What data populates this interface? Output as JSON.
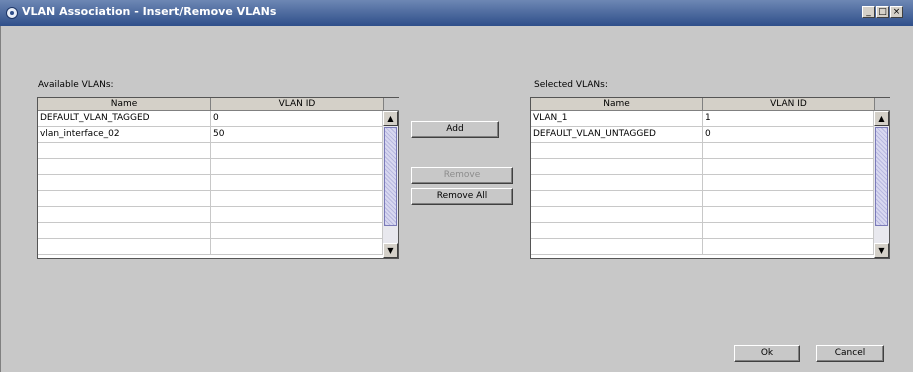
{
  "window": {
    "title": "VLAN Association - Insert/Remove VLANs",
    "controls": {
      "minimize": "_",
      "maximize": "□",
      "close": "×"
    }
  },
  "available": {
    "label": "Available VLANs:",
    "columns": [
      "Name",
      "VLAN ID"
    ],
    "rows": [
      [
        "DEFAULT_VLAN_TAGGED",
        "0"
      ],
      [
        "vlan_interface_02",
        "50"
      ],
      [
        "",
        ""
      ],
      [
        "",
        ""
      ],
      [
        "",
        ""
      ],
      [
        "",
        ""
      ],
      [
        "",
        ""
      ],
      [
        "",
        ""
      ],
      [
        "",
        ""
      ]
    ]
  },
  "selected": {
    "label": "Selected VLANs:",
    "columns": [
      "Name",
      "VLAN ID"
    ],
    "rows": [
      [
        "VLAN_1",
        "1"
      ],
      [
        "DEFAULT_VLAN_UNTAGGED",
        "0"
      ],
      [
        "",
        ""
      ],
      [
        "",
        ""
      ],
      [
        "",
        ""
      ],
      [
        "",
        ""
      ],
      [
        "",
        ""
      ],
      [
        "",
        ""
      ],
      [
        "",
        ""
      ]
    ]
  },
  "actions": {
    "add": "Add",
    "remove": "Remove",
    "remove_all": "Remove All",
    "remove_enabled": false
  },
  "footer": {
    "ok": "Ok",
    "cancel": "Cancel"
  },
  "scroll_icons": {
    "up": "▲",
    "down": "▼"
  },
  "colors": {
    "titlebar": "#2f4f8a",
    "background": "#c8c8c8",
    "thumb": "#b8b8e0"
  }
}
